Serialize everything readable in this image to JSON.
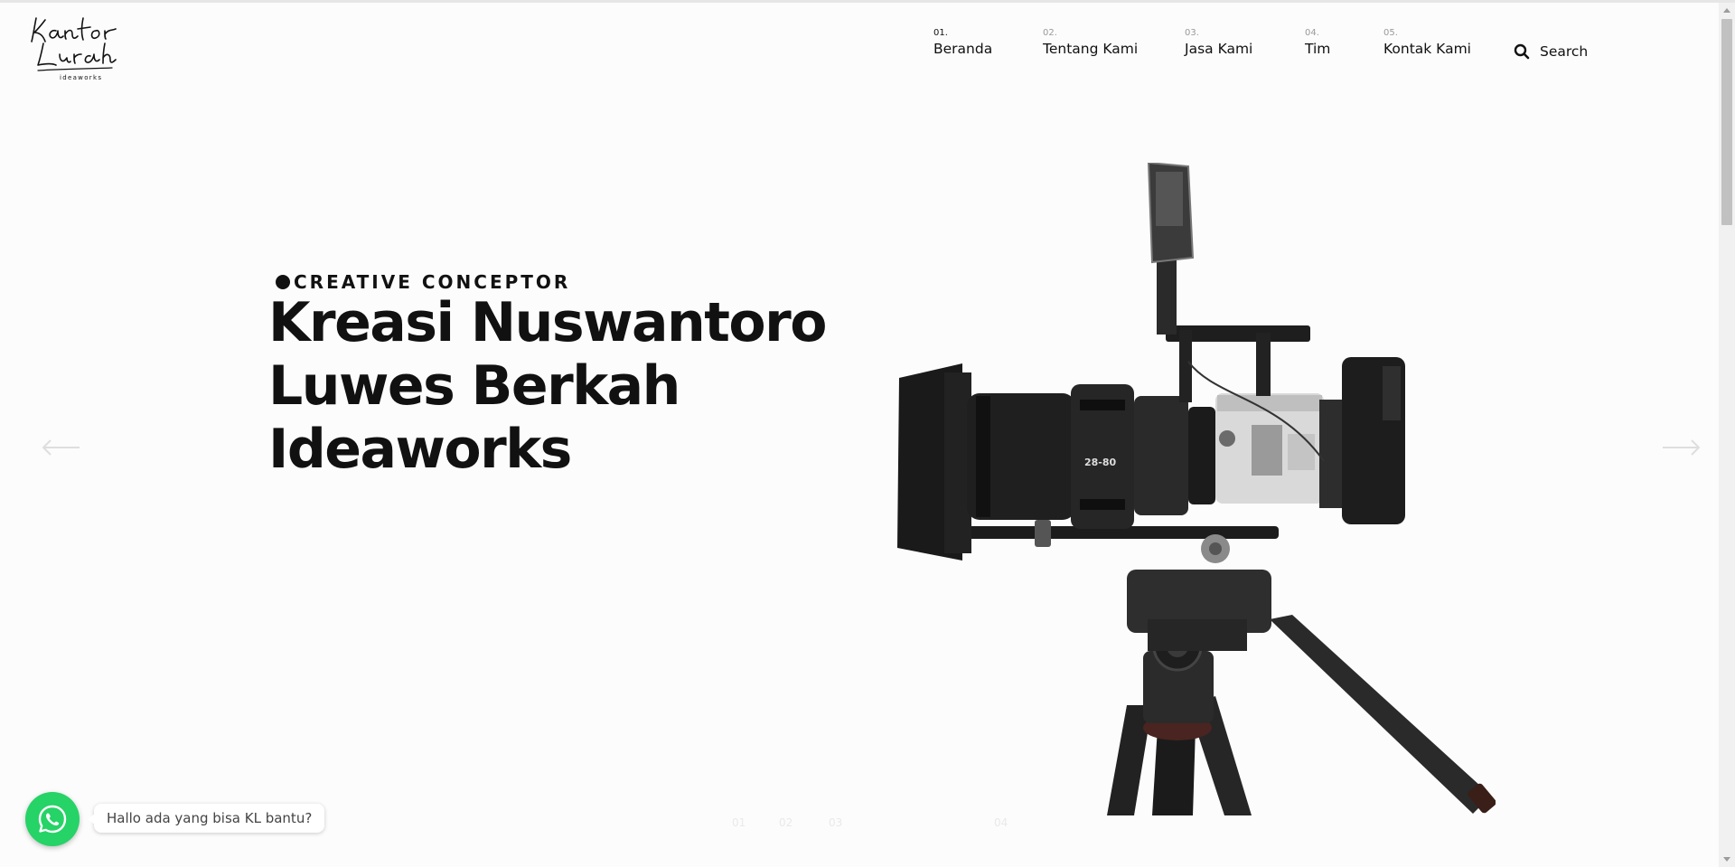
{
  "logo": {
    "alt": "Kantor Lurah ideaworks",
    "script_text": "Kantor Lurah",
    "sub_text": "ideaworks"
  },
  "nav": {
    "items": [
      {
        "num": "01.",
        "label": "Beranda",
        "active": true
      },
      {
        "num": "02.",
        "label": "Tentang Kami",
        "active": false
      },
      {
        "num": "03.",
        "label": "Jasa Kami",
        "active": false
      },
      {
        "num": "04.",
        "label": "Tim",
        "active": false
      },
      {
        "num": "05.",
        "label": "Kontak Kami",
        "active": false
      }
    ],
    "search_label": "Search",
    "search_icon": "search-icon"
  },
  "hero": {
    "kicker": "CREATIVE CONCEPTOR",
    "headline": [
      "Kreasi Nuswantoro",
      "Luwes Berkah",
      "Ideaworks"
    ],
    "image": "cinema-camera-on-tripod"
  },
  "slider": {
    "pages": [
      "01",
      "02",
      "03",
      "04"
    ]
  },
  "whatsapp": {
    "icon": "whatsapp-icon",
    "message": "Hallo ada yang bisa KL bantu?",
    "color": "#25d366"
  },
  "colors": {
    "background": "#fcfcfc",
    "text": "#111111",
    "muted": "#9a9a9a"
  }
}
